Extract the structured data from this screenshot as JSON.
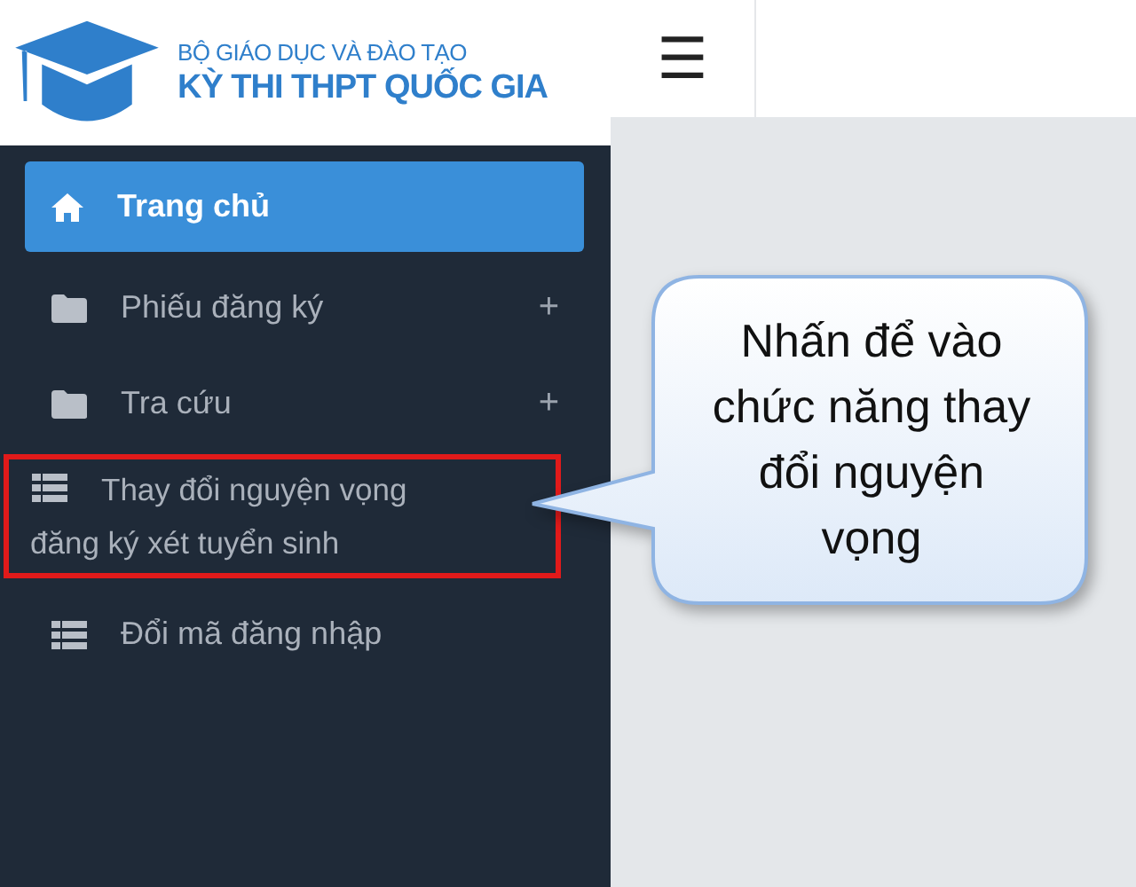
{
  "brand": {
    "ministry": "BỘ GIÁO DỤC VÀ ĐÀO TẠO",
    "title": "KỲ THI THPT QUỐC GIA"
  },
  "menu_button": {
    "label": "☰"
  },
  "sidebar": {
    "items": [
      {
        "label": "Trang chủ",
        "kind": "home",
        "selected": true,
        "highlighted": false
      },
      {
        "label": "Phiếu đăng ký",
        "kind": "folder",
        "selected": false,
        "highlighted": false,
        "expand": "+"
      },
      {
        "label": "Tra cứu",
        "kind": "folder",
        "selected": false,
        "highlighted": false,
        "expand": "+"
      },
      {
        "label": "Thay đổi nguyện vọng đăng ký xét tuyển sinh",
        "kind": "list",
        "selected": false,
        "highlighted": true
      },
      {
        "label": "Đổi mã đăng nhập",
        "kind": "list",
        "selected": false,
        "highlighted": false
      }
    ]
  },
  "callout": {
    "text": "Nhấn để vào chức năng thay đổi nguyện vọng"
  }
}
